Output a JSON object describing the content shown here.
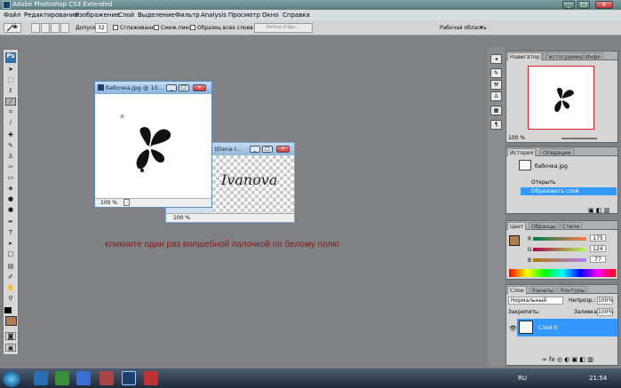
{
  "window": {
    "title": "Adobe Photoshop CS3 Extended",
    "minimize": "_",
    "maximize": "□",
    "close": "x"
  },
  "menu": [
    "Файл",
    "Редактирование",
    "Изображение",
    "Слой",
    "Выделение",
    "Фильтр",
    "Analysis",
    "Просмотр",
    "Окно",
    "Справка"
  ],
  "options": {
    "tolerance_label": "Допуск:",
    "tolerance_value": "32",
    "antialias": "Сглаживание",
    "contiguous": "Смеж.пикс",
    "sample_all": "Образец всех слоев",
    "refine_edge": "Refine Edge...",
    "workspace": "Рабочая область"
  },
  "doc1": {
    "title": "бабочка.jpg @ 10...",
    "zoom": "100 %"
  },
  "doc2": {
    "title": "% (Elena I...",
    "zoom": "100 %",
    "art_text": "Ivanova"
  },
  "caption": "кликните один раз волшебной палочкой по белому полю",
  "navigator": {
    "tabs": [
      "Навигатор",
      "Гистограмма",
      "Инфо"
    ],
    "zoom": "100 %"
  },
  "history": {
    "tabs": [
      "История",
      "Операции"
    ],
    "snapshot": "бабочка.jpg",
    "items": [
      "Открыть",
      "Образовать слой"
    ]
  },
  "color": {
    "tabs": [
      "Цвет",
      "Образцы",
      "Стили"
    ],
    "r_label": "R",
    "r": "175",
    "g_label": "G",
    "g": "124",
    "b_label": "B",
    "b": "77",
    "fg": "#af7c4d"
  },
  "layers": {
    "tabs": [
      "Слои",
      "Каналы",
      "Контуры"
    ],
    "blend": "Нормальный",
    "opacity_label": "Непрозр.:",
    "opacity": "100%",
    "lock_label": "Закрепить:",
    "fill_label": "Заливка:",
    "fill": "100%",
    "layer_name": "Слой 0"
  },
  "taskbar": {
    "lang": "RU",
    "time": "21:54"
  },
  "colors": {
    "accent": "#3399ff",
    "caption": "#8b1a1a"
  }
}
